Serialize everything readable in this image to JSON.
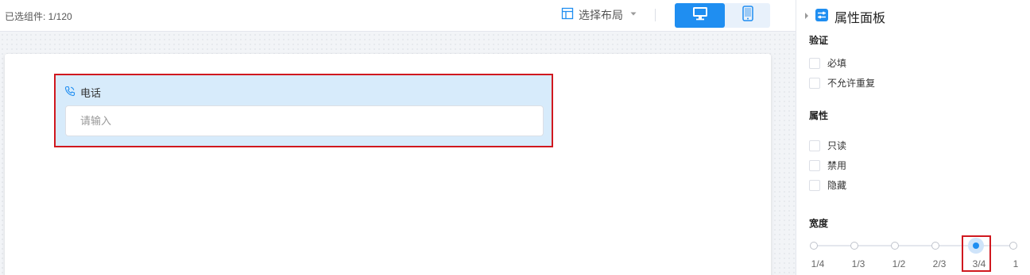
{
  "toolbar": {
    "selected_count": "已选组件:  1/120",
    "layout_label": "选择布局",
    "desktop_icon": "desktop-icon",
    "mobile_icon": "tablet-icon"
  },
  "form": {
    "field_label": "电话",
    "field_icon": "phone-icon",
    "input_placeholder": "请输入"
  },
  "panel": {
    "title": "属性面板",
    "validation": {
      "title": "验证",
      "options": [
        "必填",
        "不允许重复"
      ]
    },
    "attributes": {
      "title": "属性",
      "options": [
        "只读",
        "禁用",
        "隐藏"
      ]
    },
    "width": {
      "title": "宽度",
      "stops": [
        "1/4",
        "1/3",
        "1/2",
        "2/3",
        "3/4",
        "1"
      ],
      "selected": "3/4"
    }
  },
  "colors": {
    "accent": "#1f8ef1",
    "selection_border": "#d0181f",
    "field_bg": "#d7ebfb"
  }
}
